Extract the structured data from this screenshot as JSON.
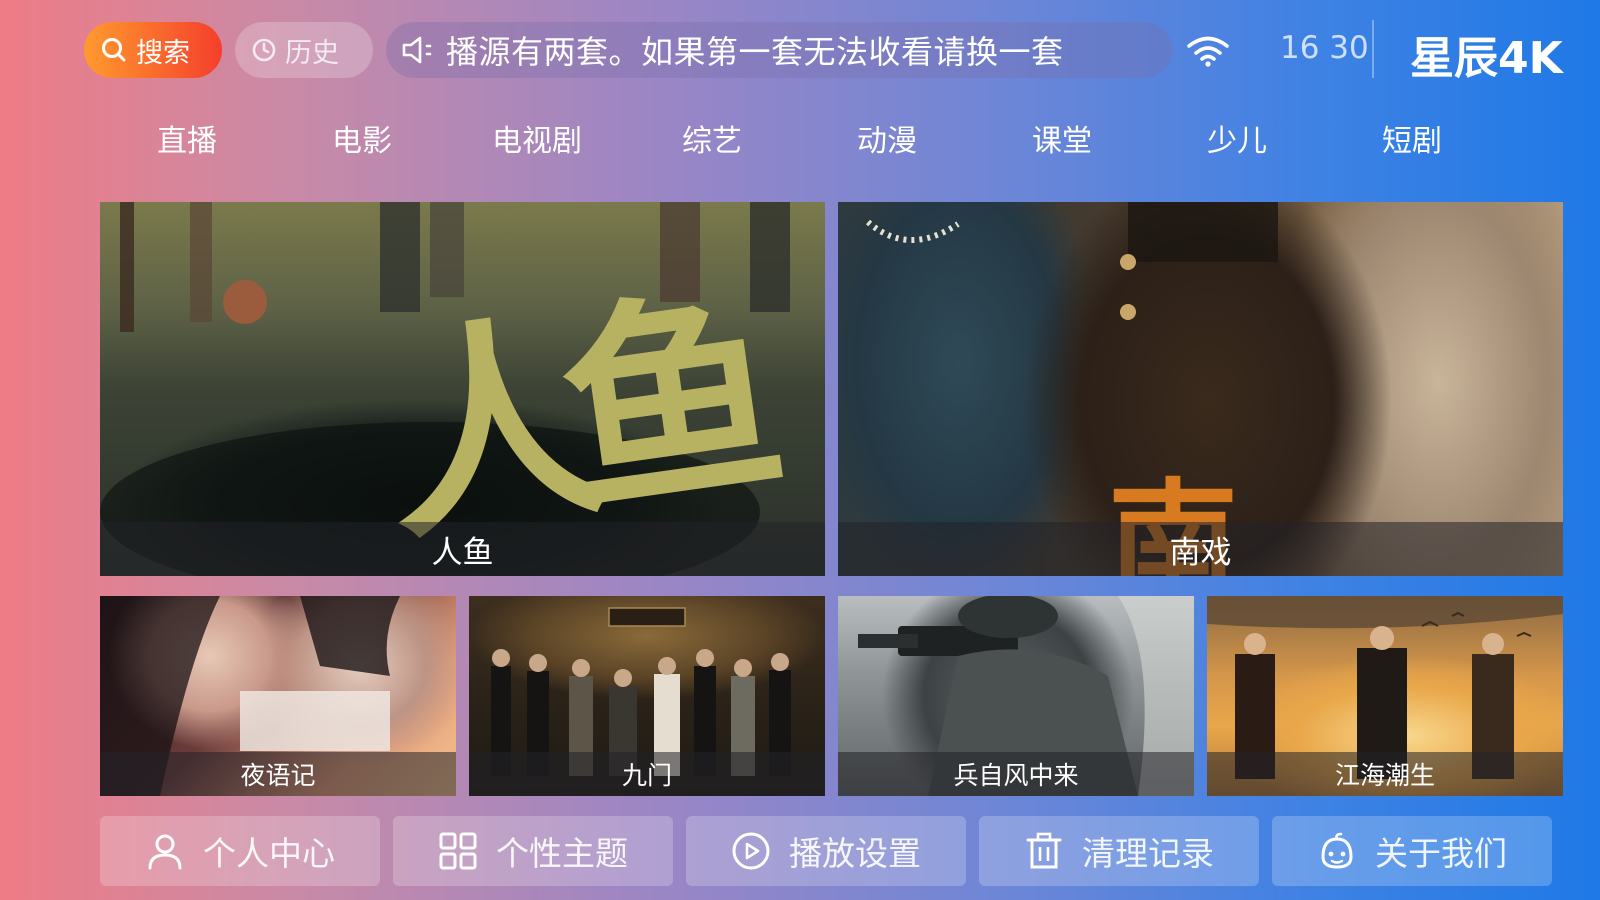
{
  "top_bar": {
    "search_label": "搜索",
    "history_label": "历史",
    "announcement": "播源有两套。如果第一套无法收看请换一套",
    "time": "16 30",
    "brand": "星辰4K"
  },
  "nav": [
    "直播",
    "电影",
    "电视剧",
    "综艺",
    "动漫",
    "课堂",
    "少儿",
    "短剧"
  ],
  "featured": [
    {
      "title": "人鱼",
      "art_text": "人鱼"
    },
    {
      "title": "南戏",
      "art_text": "南"
    }
  ],
  "grid": [
    {
      "title": "夜语记"
    },
    {
      "title": "九门"
    },
    {
      "title": "兵自风中来"
    },
    {
      "title": "江海潮生"
    }
  ],
  "bottom_menu": [
    {
      "label": "个人中心",
      "icon": "user-icon"
    },
    {
      "label": "个性主题",
      "icon": "grid-icon"
    },
    {
      "label": "播放设置",
      "icon": "play-circle-icon"
    },
    {
      "label": "清理记录",
      "icon": "trash-icon"
    },
    {
      "label": "关于我们",
      "icon": "robot-icon"
    }
  ],
  "colors": {
    "search_pill": "#f4552c",
    "caption_bg": "#232328",
    "calligraphy": "#b7b262"
  }
}
